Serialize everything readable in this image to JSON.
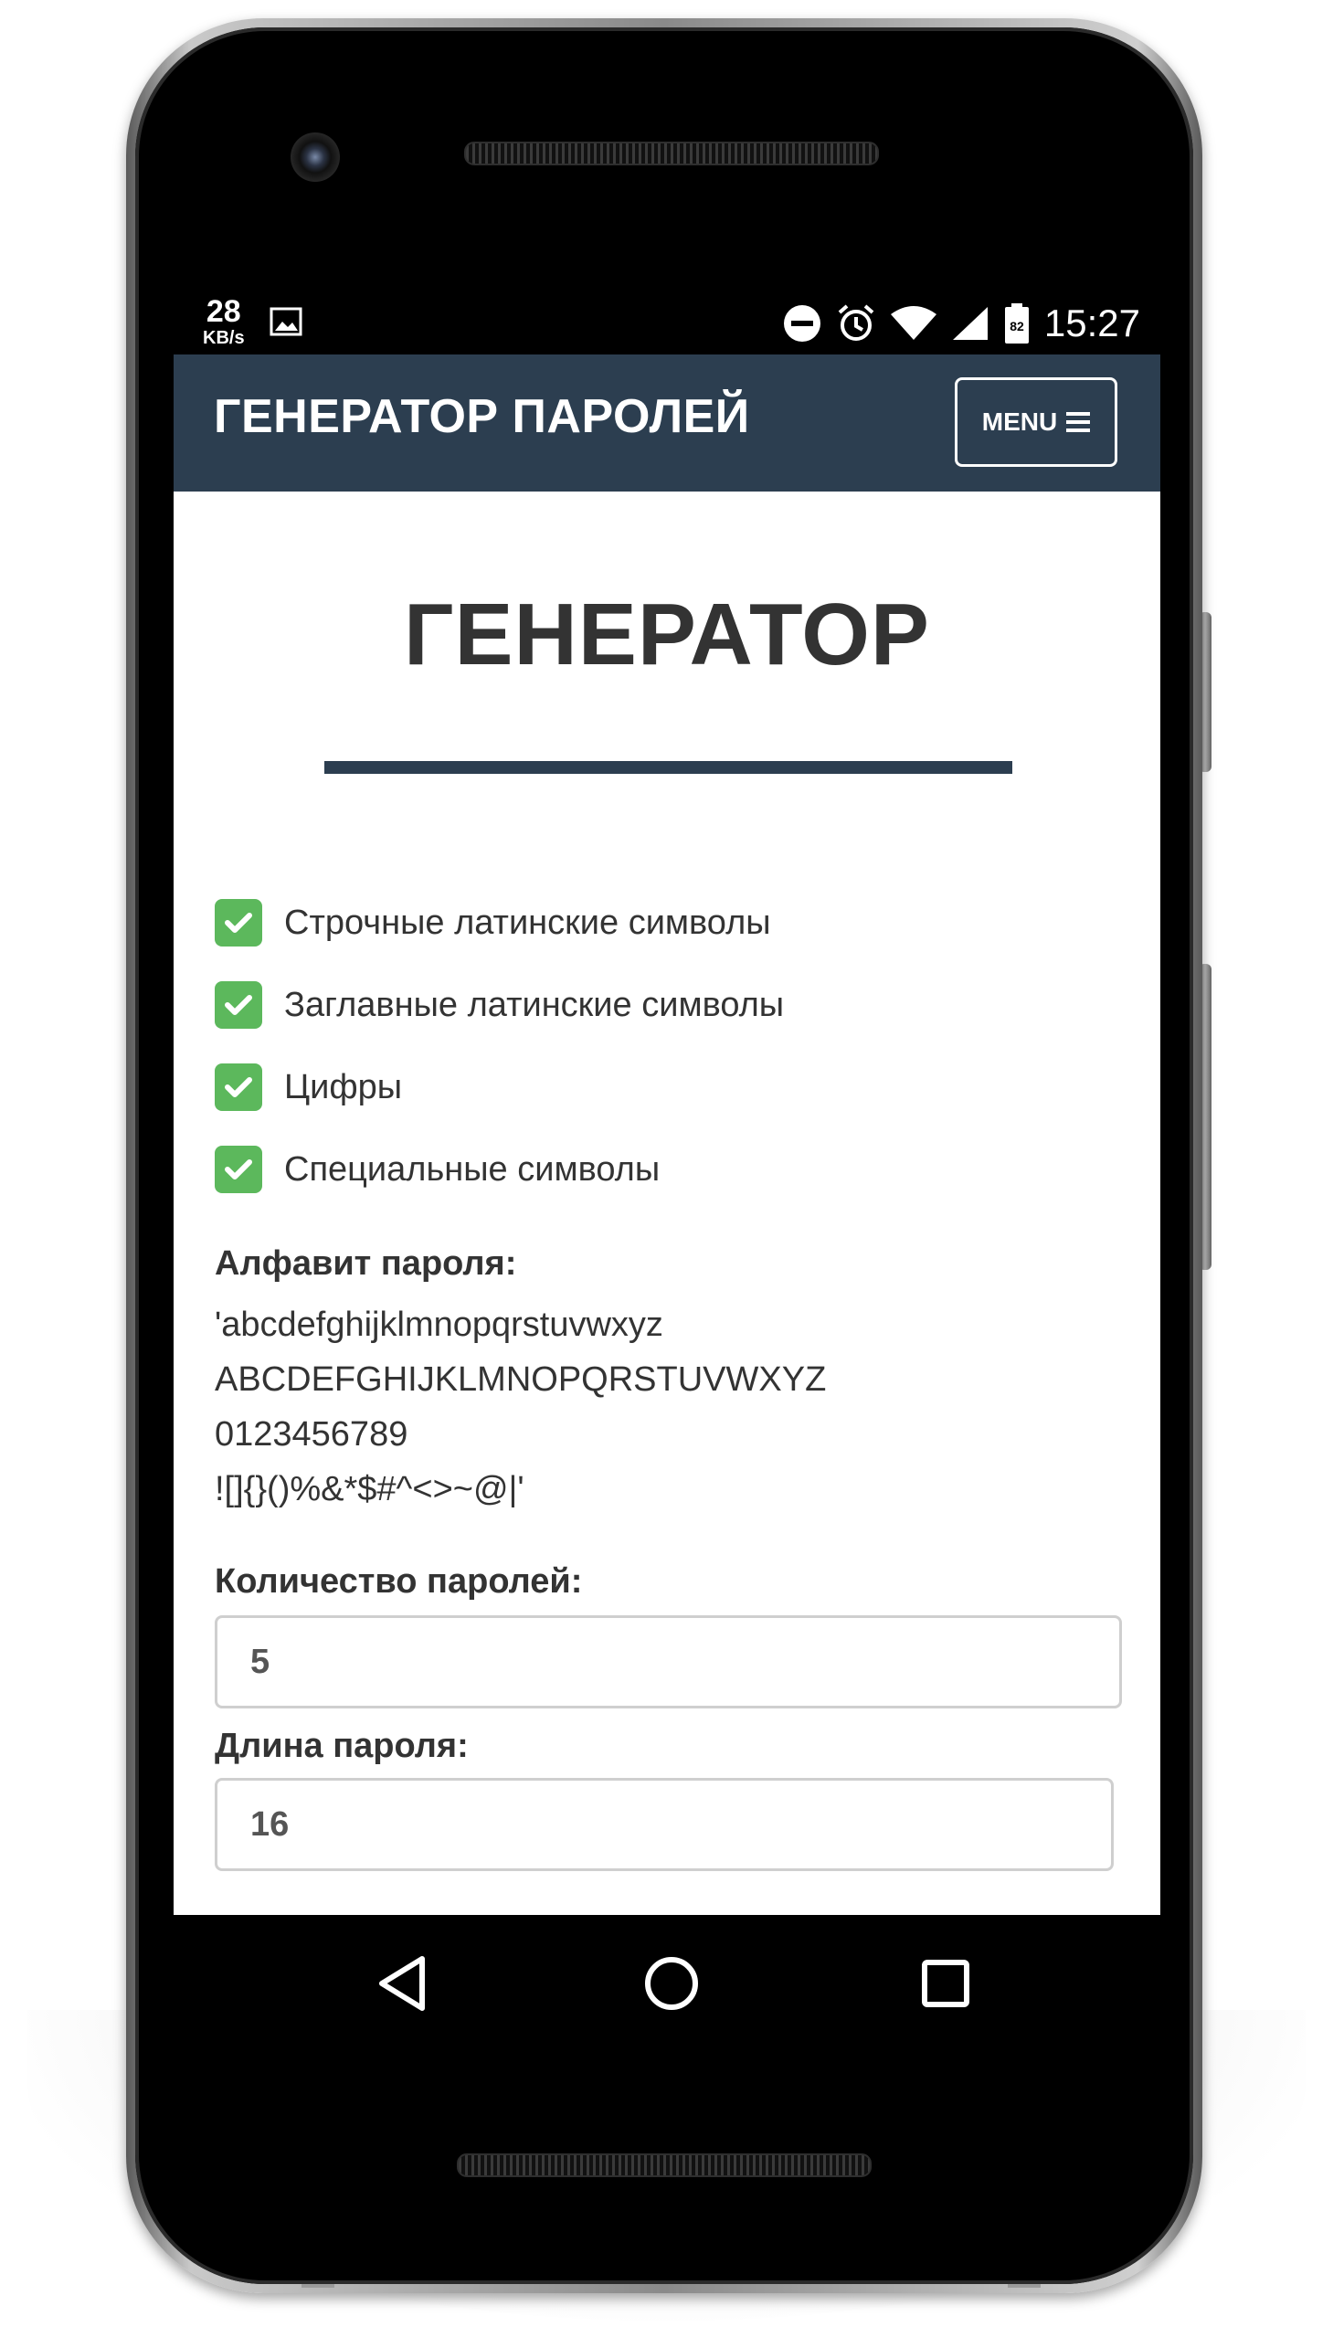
{
  "status_bar": {
    "net_speed": "28",
    "net_unit": "KB/s",
    "battery": "82",
    "time": "15:27",
    "icons": [
      "image-icon",
      "dnd-icon",
      "alarm-icon",
      "wifi-icon",
      "signal-icon",
      "battery-icon"
    ]
  },
  "header": {
    "title": "ГЕНЕРАТОР ПАРОЛЕЙ",
    "menu_label": "MENU"
  },
  "main": {
    "heading": "ГЕНЕРАТОР",
    "options": [
      {
        "label": "Строчные латинские символы",
        "checked": true
      },
      {
        "label": "Заглавные латинские символы",
        "checked": true
      },
      {
        "label": "Цифры",
        "checked": true
      },
      {
        "label": "Специальные символы",
        "checked": true
      }
    ],
    "alphabet": {
      "label": "Алфавит пароля:",
      "lines": [
        "'abcdefghijklmnopqrstuvwxyz",
        "ABCDEFGHIJKLMNOPQRSTUVWXYZ",
        "0123456789",
        "![]{}()%&*$#^<>~@|'"
      ]
    },
    "count": {
      "label": "Количество паролей:",
      "value": "5"
    },
    "length": {
      "label": "Длина пароля:",
      "value": "16"
    }
  },
  "colors": {
    "header_bg": "#2c3e50",
    "checkbox": "#5cb85c",
    "text": "#333333"
  },
  "nav": {
    "icons": [
      "back-icon",
      "home-icon",
      "recents-icon"
    ]
  }
}
